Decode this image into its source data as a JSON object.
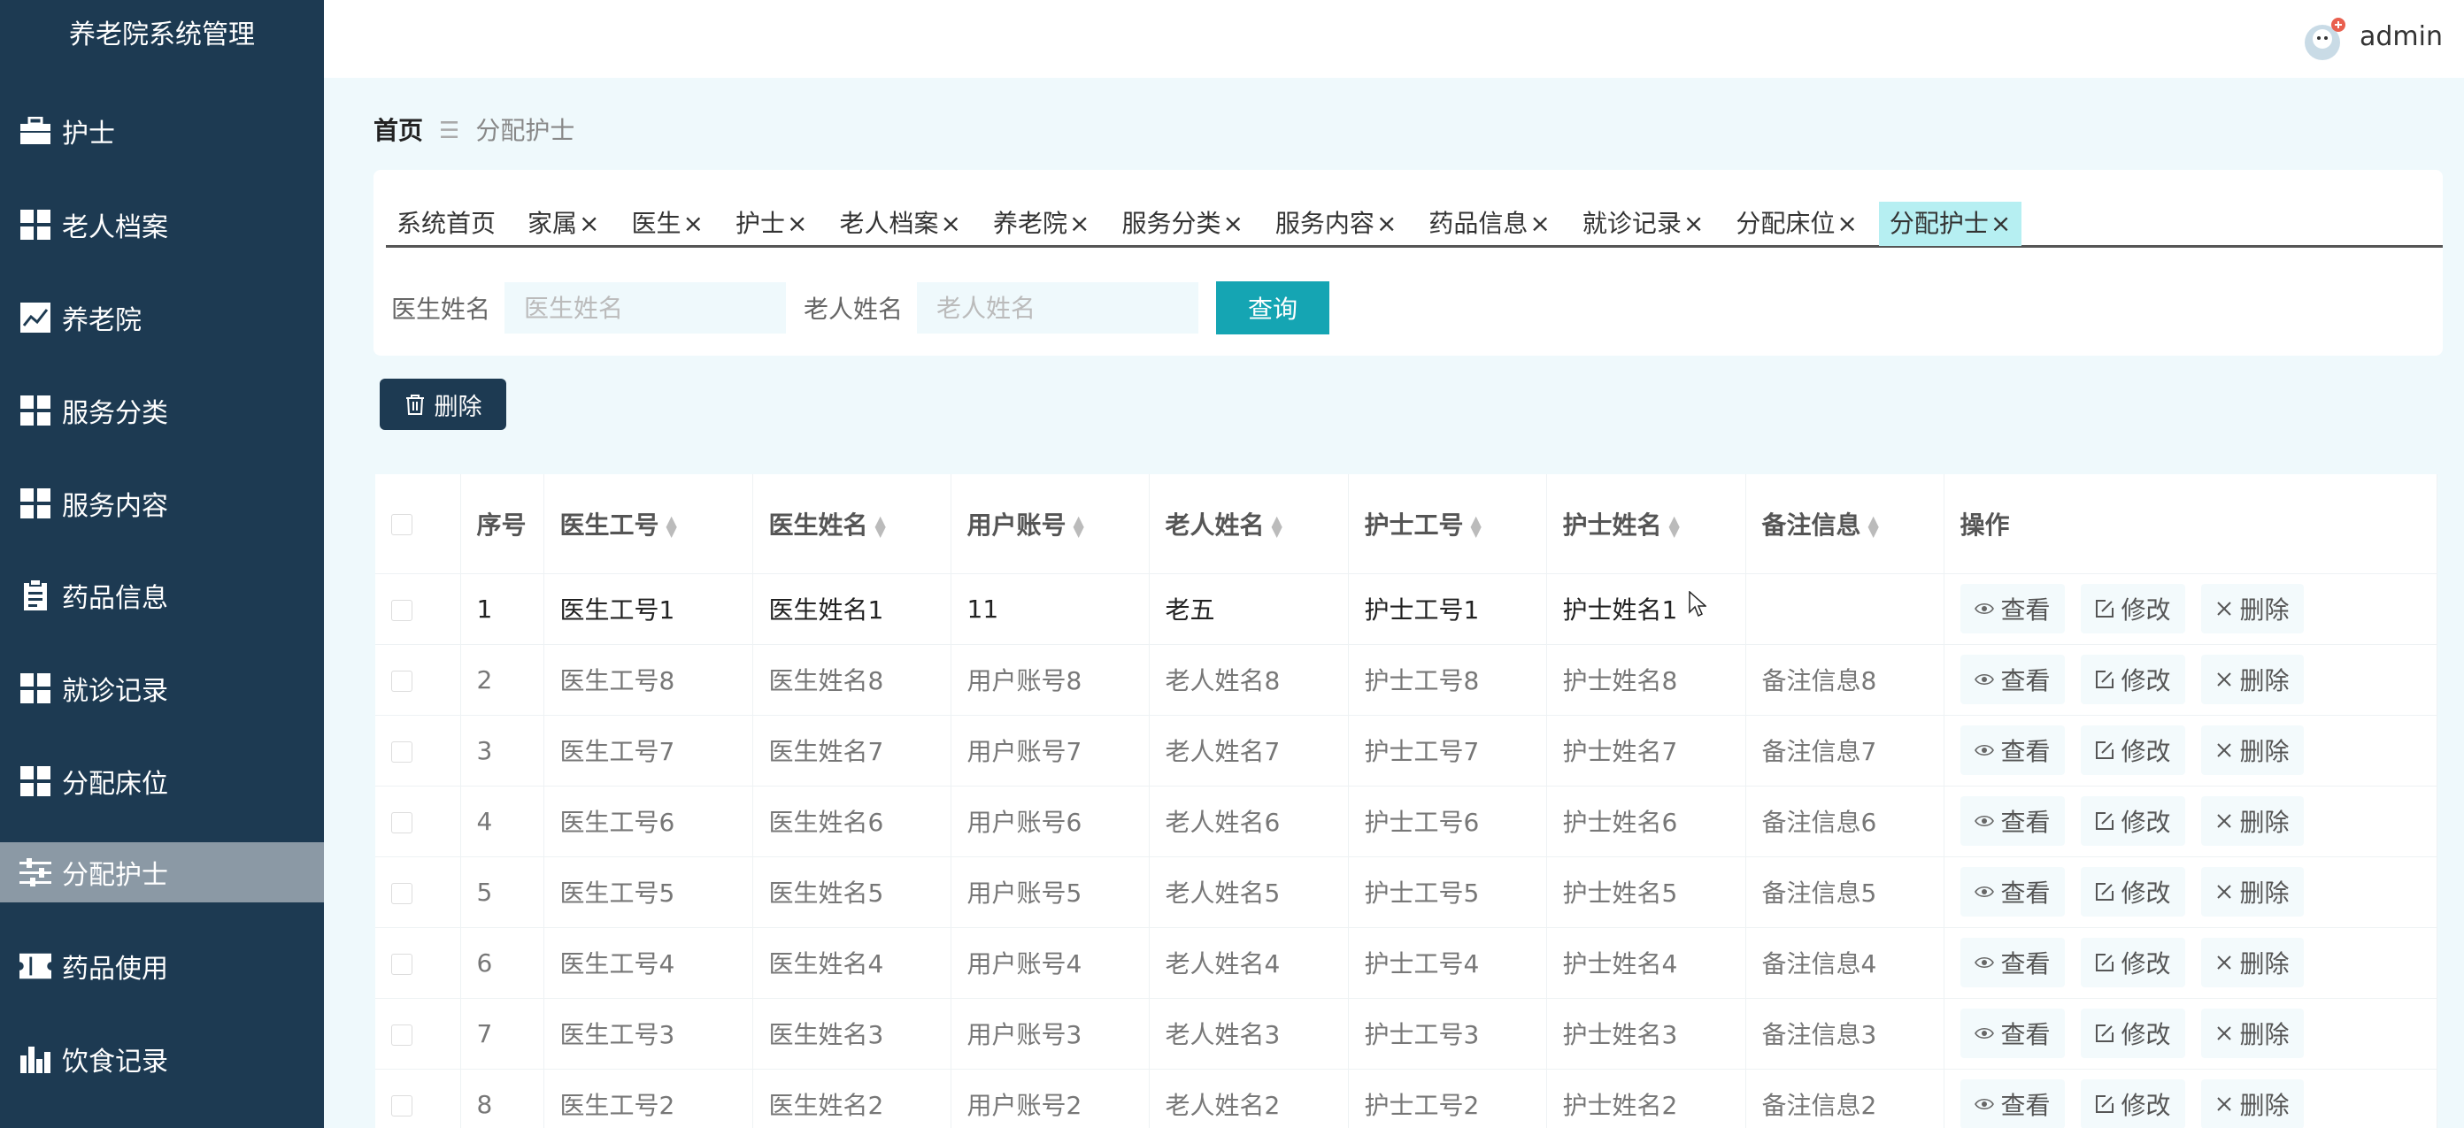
{
  "sidebar": {
    "title": "养老院系统管理",
    "items": [
      {
        "label": "护士",
        "icon": "briefcase-icon"
      },
      {
        "label": "老人档案",
        "icon": "grid-icon"
      },
      {
        "label": "养老院",
        "icon": "trend-chart-icon"
      },
      {
        "label": "服务分类",
        "icon": "grid-icon"
      },
      {
        "label": "服务内容",
        "icon": "grid-icon"
      },
      {
        "label": "药品信息",
        "icon": "clipboard-icon"
      },
      {
        "label": "就诊记录",
        "icon": "grid-icon"
      },
      {
        "label": "分配床位",
        "icon": "grid-icon"
      },
      {
        "label": "分配护士",
        "icon": "sliders-icon",
        "active": true
      },
      {
        "label": "药品使用",
        "icon": "ticket-icon"
      },
      {
        "label": "饮食记录",
        "icon": "bar-chart-icon"
      }
    ]
  },
  "header": {
    "username": "admin"
  },
  "breadcrumb": {
    "home": "首页",
    "separator": "☰",
    "current": "分配护士"
  },
  "tabs": [
    {
      "label": "系统首页",
      "closable": false
    },
    {
      "label": "家属",
      "closable": true
    },
    {
      "label": "医生",
      "closable": true
    },
    {
      "label": "护士",
      "closable": true
    },
    {
      "label": "老人档案",
      "closable": true
    },
    {
      "label": "养老院",
      "closable": true
    },
    {
      "label": "服务分类",
      "closable": true
    },
    {
      "label": "服务内容",
      "closable": true
    },
    {
      "label": "药品信息",
      "closable": true
    },
    {
      "label": "就诊记录",
      "closable": true
    },
    {
      "label": "分配床位",
      "closable": true
    },
    {
      "label": "分配护士",
      "closable": true,
      "active": true
    }
  ],
  "search": {
    "doctor_label": "医生姓名",
    "doctor_placeholder": "医生姓名",
    "elder_label": "老人姓名",
    "elder_placeholder": "老人姓名",
    "query_button": "查询"
  },
  "toolbar": {
    "delete_button": "删除"
  },
  "table": {
    "columns": [
      "序号",
      "医生工号",
      "医生姓名",
      "用户账号",
      "老人姓名",
      "护士工号",
      "护士姓名",
      "备注信息",
      "操作"
    ],
    "ops": {
      "view": "查看",
      "edit": "修改",
      "delete": "删除"
    },
    "rows": [
      [
        "1",
        "医生工号1",
        "医生姓名1",
        "11",
        "老五",
        "护士工号1",
        "护士姓名1",
        ""
      ],
      [
        "2",
        "医生工号8",
        "医生姓名8",
        "用户账号8",
        "老人姓名8",
        "护士工号8",
        "护士姓名8",
        "备注信息8"
      ],
      [
        "3",
        "医生工号7",
        "医生姓名7",
        "用户账号7",
        "老人姓名7",
        "护士工号7",
        "护士姓名7",
        "备注信息7"
      ],
      [
        "4",
        "医生工号6",
        "医生姓名6",
        "用户账号6",
        "老人姓名6",
        "护士工号6",
        "护士姓名6",
        "备注信息6"
      ],
      [
        "5",
        "医生工号5",
        "医生姓名5",
        "用户账号5",
        "老人姓名5",
        "护士工号5",
        "护士姓名5",
        "备注信息5"
      ],
      [
        "6",
        "医生工号4",
        "医生姓名4",
        "用户账号4",
        "老人姓名4",
        "护士工号4",
        "护士姓名4",
        "备注信息4"
      ],
      [
        "7",
        "医生工号3",
        "医生姓名3",
        "用户账号3",
        "老人姓名3",
        "护士工号3",
        "护士姓名3",
        "备注信息3"
      ],
      [
        "8",
        "医生工号2",
        "医生姓名2",
        "用户账号2",
        "老人姓名2",
        "护士工号2",
        "护士姓名2",
        "备注信息2"
      ]
    ]
  },
  "colors": {
    "sidebar": "#1d3a52",
    "accent": "#15a5b3",
    "active_tab": "#b6eff2",
    "background": "#eff9fc"
  }
}
